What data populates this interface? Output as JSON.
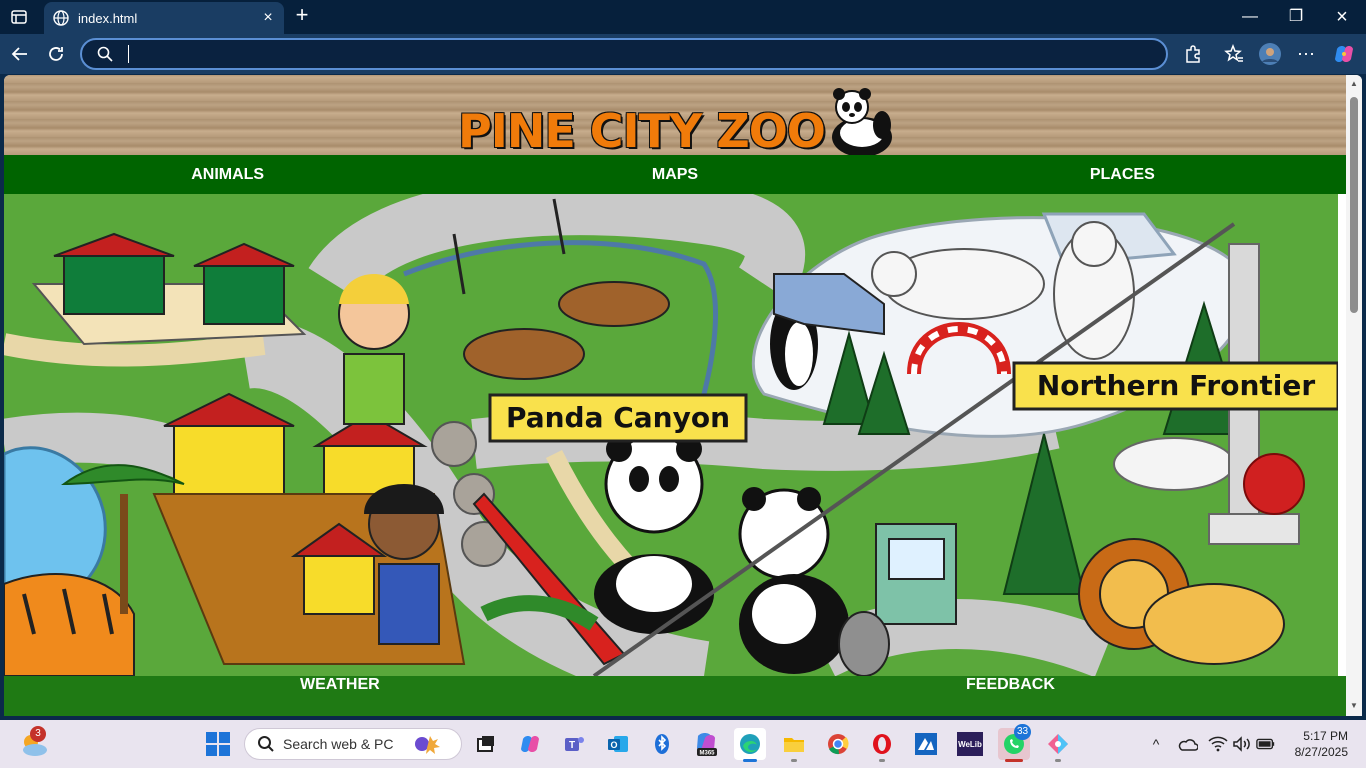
{
  "browser": {
    "tab_title": "index.html",
    "address_value": "",
    "address_placeholder": ""
  },
  "page": {
    "logo_text": "PINE CITY ZOO",
    "top_nav": [
      "ANIMALS",
      "MAPS",
      "PLACES"
    ],
    "bottom_nav": [
      "WEATHER",
      "FEEDBACK"
    ],
    "map_labels": {
      "panda": "Panda Canyon",
      "north": "Northern Frontier"
    }
  },
  "taskbar": {
    "search_label": "Search web & PC",
    "weather_badge": "3",
    "whatsapp_badge": "33",
    "time": "5:17 PM",
    "date": "8/27/2025",
    "m365_label": "M365",
    "welib_label": "WeLib"
  },
  "colors": {
    "nav_green": "#006400",
    "bottom_green": "#1f7a14",
    "logo_orange": "#f07b0a",
    "chrome_dark": "#06203c",
    "chrome_mid": "#1a3d63"
  }
}
